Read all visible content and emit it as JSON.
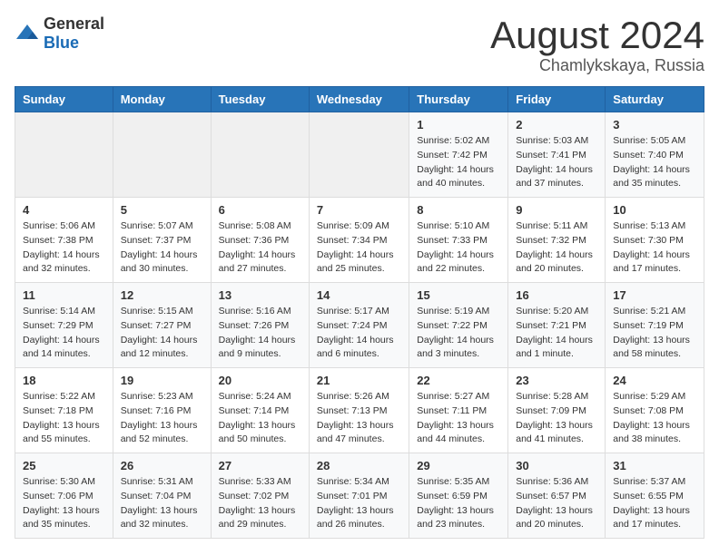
{
  "logo": {
    "general": "General",
    "blue": "Blue"
  },
  "header": {
    "month": "August 2024",
    "location": "Chamlykskaya, Russia"
  },
  "weekdays": [
    "Sunday",
    "Monday",
    "Tuesday",
    "Wednesday",
    "Thursday",
    "Friday",
    "Saturday"
  ],
  "weeks": [
    [
      {
        "day": "",
        "sunrise": "",
        "sunset": "",
        "daylight": ""
      },
      {
        "day": "",
        "sunrise": "",
        "sunset": "",
        "daylight": ""
      },
      {
        "day": "",
        "sunrise": "",
        "sunset": "",
        "daylight": ""
      },
      {
        "day": "",
        "sunrise": "",
        "sunset": "",
        "daylight": ""
      },
      {
        "day": "1",
        "sunrise": "Sunrise: 5:02 AM",
        "sunset": "Sunset: 7:42 PM",
        "daylight": "Daylight: 14 hours and 40 minutes."
      },
      {
        "day": "2",
        "sunrise": "Sunrise: 5:03 AM",
        "sunset": "Sunset: 7:41 PM",
        "daylight": "Daylight: 14 hours and 37 minutes."
      },
      {
        "day": "3",
        "sunrise": "Sunrise: 5:05 AM",
        "sunset": "Sunset: 7:40 PM",
        "daylight": "Daylight: 14 hours and 35 minutes."
      }
    ],
    [
      {
        "day": "4",
        "sunrise": "Sunrise: 5:06 AM",
        "sunset": "Sunset: 7:38 PM",
        "daylight": "Daylight: 14 hours and 32 minutes."
      },
      {
        "day": "5",
        "sunrise": "Sunrise: 5:07 AM",
        "sunset": "Sunset: 7:37 PM",
        "daylight": "Daylight: 14 hours and 30 minutes."
      },
      {
        "day": "6",
        "sunrise": "Sunrise: 5:08 AM",
        "sunset": "Sunset: 7:36 PM",
        "daylight": "Daylight: 14 hours and 27 minutes."
      },
      {
        "day": "7",
        "sunrise": "Sunrise: 5:09 AM",
        "sunset": "Sunset: 7:34 PM",
        "daylight": "Daylight: 14 hours and 25 minutes."
      },
      {
        "day": "8",
        "sunrise": "Sunrise: 5:10 AM",
        "sunset": "Sunset: 7:33 PM",
        "daylight": "Daylight: 14 hours and 22 minutes."
      },
      {
        "day": "9",
        "sunrise": "Sunrise: 5:11 AM",
        "sunset": "Sunset: 7:32 PM",
        "daylight": "Daylight: 14 hours and 20 minutes."
      },
      {
        "day": "10",
        "sunrise": "Sunrise: 5:13 AM",
        "sunset": "Sunset: 7:30 PM",
        "daylight": "Daylight: 14 hours and 17 minutes."
      }
    ],
    [
      {
        "day": "11",
        "sunrise": "Sunrise: 5:14 AM",
        "sunset": "Sunset: 7:29 PM",
        "daylight": "Daylight: 14 hours and 14 minutes."
      },
      {
        "day": "12",
        "sunrise": "Sunrise: 5:15 AM",
        "sunset": "Sunset: 7:27 PM",
        "daylight": "Daylight: 14 hours and 12 minutes."
      },
      {
        "day": "13",
        "sunrise": "Sunrise: 5:16 AM",
        "sunset": "Sunset: 7:26 PM",
        "daylight": "Daylight: 14 hours and 9 minutes."
      },
      {
        "day": "14",
        "sunrise": "Sunrise: 5:17 AM",
        "sunset": "Sunset: 7:24 PM",
        "daylight": "Daylight: 14 hours and 6 minutes."
      },
      {
        "day": "15",
        "sunrise": "Sunrise: 5:19 AM",
        "sunset": "Sunset: 7:22 PM",
        "daylight": "Daylight: 14 hours and 3 minutes."
      },
      {
        "day": "16",
        "sunrise": "Sunrise: 5:20 AM",
        "sunset": "Sunset: 7:21 PM",
        "daylight": "Daylight: 14 hours and 1 minute."
      },
      {
        "day": "17",
        "sunrise": "Sunrise: 5:21 AM",
        "sunset": "Sunset: 7:19 PM",
        "daylight": "Daylight: 13 hours and 58 minutes."
      }
    ],
    [
      {
        "day": "18",
        "sunrise": "Sunrise: 5:22 AM",
        "sunset": "Sunset: 7:18 PM",
        "daylight": "Daylight: 13 hours and 55 minutes."
      },
      {
        "day": "19",
        "sunrise": "Sunrise: 5:23 AM",
        "sunset": "Sunset: 7:16 PM",
        "daylight": "Daylight: 13 hours and 52 minutes."
      },
      {
        "day": "20",
        "sunrise": "Sunrise: 5:24 AM",
        "sunset": "Sunset: 7:14 PM",
        "daylight": "Daylight: 13 hours and 50 minutes."
      },
      {
        "day": "21",
        "sunrise": "Sunrise: 5:26 AM",
        "sunset": "Sunset: 7:13 PM",
        "daylight": "Daylight: 13 hours and 47 minutes."
      },
      {
        "day": "22",
        "sunrise": "Sunrise: 5:27 AM",
        "sunset": "Sunset: 7:11 PM",
        "daylight": "Daylight: 13 hours and 44 minutes."
      },
      {
        "day": "23",
        "sunrise": "Sunrise: 5:28 AM",
        "sunset": "Sunset: 7:09 PM",
        "daylight": "Daylight: 13 hours and 41 minutes."
      },
      {
        "day": "24",
        "sunrise": "Sunrise: 5:29 AM",
        "sunset": "Sunset: 7:08 PM",
        "daylight": "Daylight: 13 hours and 38 minutes."
      }
    ],
    [
      {
        "day": "25",
        "sunrise": "Sunrise: 5:30 AM",
        "sunset": "Sunset: 7:06 PM",
        "daylight": "Daylight: 13 hours and 35 minutes."
      },
      {
        "day": "26",
        "sunrise": "Sunrise: 5:31 AM",
        "sunset": "Sunset: 7:04 PM",
        "daylight": "Daylight: 13 hours and 32 minutes."
      },
      {
        "day": "27",
        "sunrise": "Sunrise: 5:33 AM",
        "sunset": "Sunset: 7:02 PM",
        "daylight": "Daylight: 13 hours and 29 minutes."
      },
      {
        "day": "28",
        "sunrise": "Sunrise: 5:34 AM",
        "sunset": "Sunset: 7:01 PM",
        "daylight": "Daylight: 13 hours and 26 minutes."
      },
      {
        "day": "29",
        "sunrise": "Sunrise: 5:35 AM",
        "sunset": "Sunset: 6:59 PM",
        "daylight": "Daylight: 13 hours and 23 minutes."
      },
      {
        "day": "30",
        "sunrise": "Sunrise: 5:36 AM",
        "sunset": "Sunset: 6:57 PM",
        "daylight": "Daylight: 13 hours and 20 minutes."
      },
      {
        "day": "31",
        "sunrise": "Sunrise: 5:37 AM",
        "sunset": "Sunset: 6:55 PM",
        "daylight": "Daylight: 13 hours and 17 minutes."
      }
    ]
  ]
}
